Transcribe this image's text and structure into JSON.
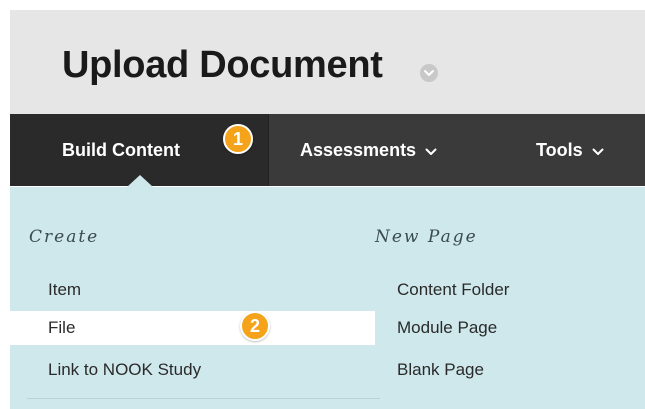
{
  "page": {
    "title": "Upload Document"
  },
  "nav": {
    "tabs": [
      {
        "label": "Build Content",
        "active": true
      },
      {
        "label": "Assessments",
        "active": false
      },
      {
        "label": "Tools",
        "active": false
      }
    ]
  },
  "callouts": [
    "1",
    "2"
  ],
  "menu": {
    "create": {
      "heading": "Create",
      "items": [
        "Item",
        "File",
        "Link to NOOK Study"
      ]
    },
    "new_page": {
      "heading": "New Page",
      "items": [
        "Content Folder",
        "Module Page",
        "Blank Page"
      ]
    },
    "highlighted_item": "File"
  },
  "colors": {
    "title_bar": "#e6e6e6",
    "nav_bar": "#3a3a3a",
    "active_tab": "#2a2a2a",
    "panel": "#cfe8ec",
    "callout": "#f5a31b",
    "highlight": "#ffffff"
  },
  "icons": {
    "title_menu": "chevron-down-circle-icon",
    "tab_dropdown": "chevron-down-icon"
  }
}
